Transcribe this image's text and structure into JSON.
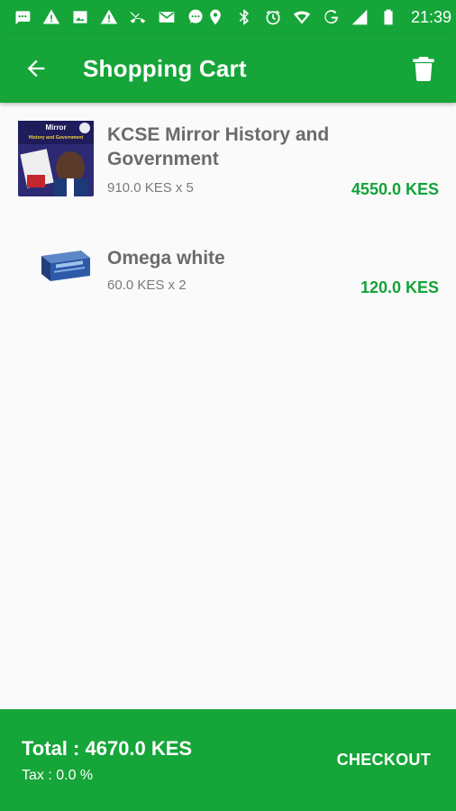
{
  "status_bar": {
    "time": "21:39",
    "left_icons": [
      "message-icon",
      "warning-icon",
      "image-icon",
      "warning-icon",
      "missed-call-icon",
      "mail-icon",
      "chat-icon"
    ],
    "right_icons": [
      "location-icon",
      "bluetooth-icon",
      "alarm-icon",
      "wifi-icon",
      "network-g-icon",
      "signal-icon",
      "battery-icon"
    ]
  },
  "app_bar": {
    "title": "Shopping Cart",
    "back_icon": "arrow-back-icon",
    "delete_icon": "trash-icon"
  },
  "cart": {
    "items": [
      {
        "name": "KCSE Mirror History and Government",
        "unit_line": "910.0 KES x 5",
        "line_total": "4550.0 KES",
        "thumb_text_1": "Mirror",
        "thumb_text_2": "History and Government"
      },
      {
        "name": "Omega white",
        "unit_line": "60.0 KES x 2",
        "line_total": "120.0 KES"
      }
    ]
  },
  "footer": {
    "total": "Total : 4670.0 KES",
    "tax": "Tax : 0.0 %",
    "checkout_label": "CHECKOUT"
  },
  "colors": {
    "primary": "#16a539",
    "price_green": "#13a23a",
    "name_gray": "#6b6b6b",
    "background": "#fafafa"
  }
}
